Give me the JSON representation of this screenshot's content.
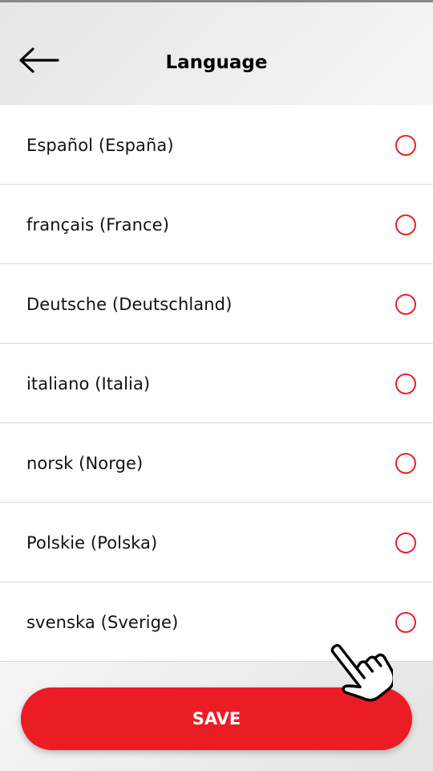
{
  "header": {
    "title": "Language",
    "back_icon": "arrow-left-icon"
  },
  "languages": [
    {
      "label": "Español (España)",
      "selected": false
    },
    {
      "label": "français (France)",
      "selected": false
    },
    {
      "label": "Deutsche (Deutschland)",
      "selected": false
    },
    {
      "label": "italiano (Italia)",
      "selected": false
    },
    {
      "label": "norsk (Norge)",
      "selected": false
    },
    {
      "label": "Polskie (Polska)",
      "selected": false
    },
    {
      "label": "svenska (Sverige)",
      "selected": false
    }
  ],
  "footer": {
    "save_label": "SAVE"
  },
  "colors": {
    "accent": "#ec1c24",
    "radio_border": "#e8202a"
  },
  "overlay": {
    "cursor_icon": "pointing-hand-icon"
  }
}
